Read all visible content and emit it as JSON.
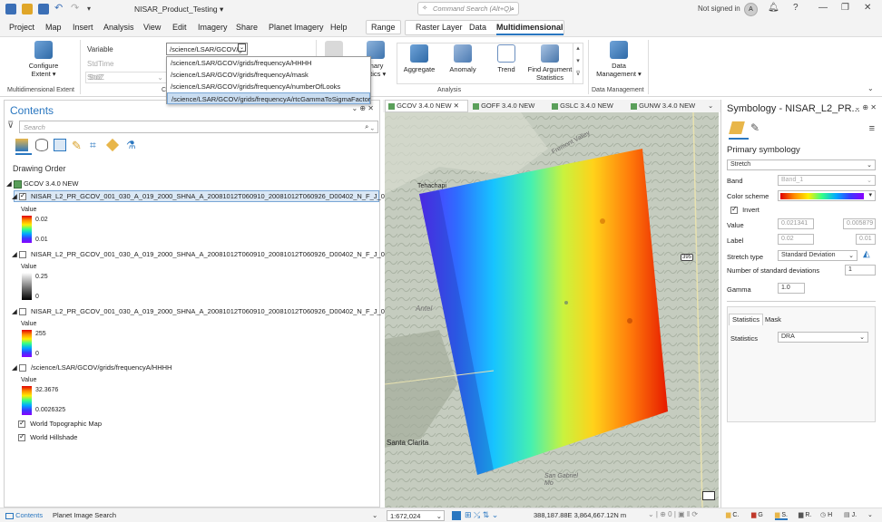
{
  "titlebar": {
    "project": "NISAR_Product_Testing ▾",
    "command_search_placeholder": "Command Search (Alt+Q)",
    "signin": "Not signed in",
    "avatar": "A",
    "help": "?"
  },
  "menu": [
    "Project",
    "Map",
    "Insert",
    "Analysis",
    "View",
    "Edit",
    "Imagery",
    "Share",
    "Planet Imagery",
    "Help"
  ],
  "context_tabs": {
    "range": "Range",
    "raster_layer": "Raster Layer",
    "data": "Data",
    "multidimensional": "Multidimensional"
  },
  "ribbon": {
    "configure": "Configure",
    "extent": "Extent ▾",
    "group_multidim_extent": "Multidimensional Extent",
    "variable_label": "Variable",
    "stdtime_label": "StdTime",
    "stdz_label": "StdZ",
    "stdz_value": "StdZ",
    "group_c": "C",
    "variable_value": "/science/LSAR/GCOV/g",
    "dropdown_items": [
      "/science/LSAR/GCOV/grids/frequencyA/HHHH",
      "/science/LSAR/GCOV/grids/frequencyA/mask",
      "/science/LSAR/GCOV/grids/frequencyA/numberOfLooks",
      "/science/LSAR/GCOV/grids/frequencyA/rtcGammaToSigmaFactor"
    ],
    "summary_partial_1": "mary",
    "summary_partial_2": "istics ▾",
    "aggregate": "Aggregate",
    "anomaly": "Anomaly",
    "trend": "Trend",
    "find_argument": "Find Argument",
    "statistics": "Statistics",
    "group_analysis": "Analysis",
    "data": "Data",
    "management": "Management ▾",
    "group_data_mgmt": "Data Management"
  },
  "contents": {
    "title": "Contents",
    "search_placeholder": "Search",
    "drawing_order": "Drawing Order",
    "map_name": "GCOV 3.4.0 NEW",
    "layers": [
      {
        "name": "NISAR_L2_PR_GCOV_001_030_A_019_2000_SHNA_A_20081012T060910_20081012T060926_D00402_N_F_J_001.h5",
        "checked": true,
        "value_label": "Value",
        "max": "0.02",
        "min": "0.01"
      },
      {
        "name": "NISAR_L2_PR_GCOV_001_030_A_019_2000_SHNA_A_20081012T060910_20081012T060926_D00402_N_F_J_001.h5_...",
        "checked": false,
        "value_label": "Value",
        "max": "0.25",
        "min": "0"
      },
      {
        "name": "NISAR_L2_PR_GCOV_001_030_A_019_2000_SHNA_A_20081012T060910_20081012T060926_D00402_N_F_J_001.h5_...",
        "checked": false,
        "value_label": "Value",
        "max": "255",
        "min": "0"
      },
      {
        "name": "/science/LSAR/GCOV/grids/frequencyA/HHHH",
        "checked": false,
        "value_label": "Value",
        "max": "32.3676",
        "min": "0.0026325"
      }
    ],
    "basemaps": [
      {
        "name": "World Topographic Map",
        "checked": true
      },
      {
        "name": "World Hillshade",
        "checked": true
      }
    ]
  },
  "map_tabs": [
    "GCOV 3.4.0 NEW",
    "GOFF 3.4.0 NEW",
    "GSLC 3.4.0 NEW",
    "GUNW 3.4.0 NEW"
  ],
  "map_labels": {
    "tehachapi": "Tehachapi",
    "fremont": "Fremont Valley",
    "antelope": "Antel",
    "santa_clarita": "Santa Clarita",
    "san_gabriel": "San Gabriel Mo",
    "highway": "395",
    "tehachapi_mtn": "Tehachapi"
  },
  "symbology": {
    "title": "Symbology - NISAR_L2_PR...",
    "primary": "Primary symbology",
    "renderer": "Stretch",
    "band_label": "Band",
    "band_value": "Band_1",
    "color_scheme_label": "Color scheme",
    "invert_label": "Invert",
    "value_label": "Value",
    "value_min": "0.021341",
    "value_max": "0.005879",
    "label_label": "Label",
    "label_min": "0.02",
    "label_max": "0.01",
    "stretch_type_label": "Stretch type",
    "stretch_type_value": "Standard Deviation",
    "nstd_label": "Number of standard deviations",
    "nstd_value": "1",
    "gamma_label": "Gamma",
    "gamma_value": "1.0",
    "tab_statistics": "Statistics",
    "tab_mask": "Mask",
    "statistics_label": "Statistics",
    "statistics_value": "DRA"
  },
  "statusbar": {
    "contents_tab": "Contents",
    "planet_tab": "Planet Image Search",
    "scale": "1:672,024",
    "coords": "388,187.88E 3,864,667.12N m",
    "bottom_tabs": [
      "C.",
      "G",
      "S.",
      "R.",
      "H",
      "J."
    ]
  }
}
